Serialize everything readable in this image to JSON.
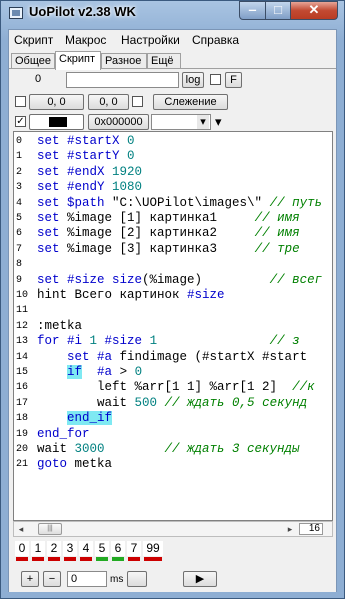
{
  "window": {
    "title": "UoPilot  v2.38  WK",
    "min_glyph": "‒",
    "max_glyph": "□",
    "close_glyph": "✕"
  },
  "menu": [
    "Скрипт",
    "Макрос",
    "Настройки",
    "Справка"
  ],
  "tabs": [
    "Общее",
    "Скрипт",
    "Разное",
    "Ещё"
  ],
  "active_tab": "Скрипт",
  "row1": {
    "value": "0",
    "log_label": "log",
    "f_label": "F"
  },
  "row2": {
    "coord1": "0, 0",
    "coord2": "0, 0",
    "tracking_label": "Слежение"
  },
  "row3": {
    "color_value": "0x000000",
    "dropdown_glyph": "▾",
    "arrow_glyph": "▾"
  },
  "code": [
    {
      "n": "0",
      "parts": [
        {
          "t": "set ",
          "c": "kw"
        },
        {
          "t": "#startX ",
          "c": "kw"
        },
        {
          "t": "0",
          "c": "num"
        }
      ]
    },
    {
      "n": "1",
      "parts": [
        {
          "t": "set ",
          "c": "kw"
        },
        {
          "t": "#startY ",
          "c": "kw"
        },
        {
          "t": "0",
          "c": "num"
        }
      ]
    },
    {
      "n": "2",
      "parts": [
        {
          "t": "set ",
          "c": "kw"
        },
        {
          "t": "#endX ",
          "c": "kw"
        },
        {
          "t": "1920",
          "c": "num"
        }
      ]
    },
    {
      "n": "3",
      "parts": [
        {
          "t": "set ",
          "c": "kw"
        },
        {
          "t": "#endY ",
          "c": "kw"
        },
        {
          "t": "1080",
          "c": "num"
        }
      ]
    },
    {
      "n": "4",
      "parts": [
        {
          "t": "set ",
          "c": "kw"
        },
        {
          "t": "$path ",
          "c": "kw"
        },
        {
          "t": "\"C:\\UOPilot\\images\\\"",
          "c": ""
        },
        {
          "t": " // путь",
          "c": "cmt"
        }
      ]
    },
    {
      "n": "5",
      "parts": [
        {
          "t": "set ",
          "c": "kw"
        },
        {
          "t": "%image ",
          "c": ""
        },
        {
          "t": "[1] картинка1     ",
          "c": ""
        },
        {
          "t": "// имя",
          "c": "cmt"
        }
      ]
    },
    {
      "n": "6",
      "parts": [
        {
          "t": "set ",
          "c": "kw"
        },
        {
          "t": "%image ",
          "c": ""
        },
        {
          "t": "[2] картинка2     ",
          "c": ""
        },
        {
          "t": "// имя",
          "c": "cmt"
        }
      ]
    },
    {
      "n": "7",
      "parts": [
        {
          "t": "set ",
          "c": "kw"
        },
        {
          "t": "%image ",
          "c": ""
        },
        {
          "t": "[3] картинка3     ",
          "c": ""
        },
        {
          "t": "// тре",
          "c": "cmt"
        }
      ]
    },
    {
      "n": "8",
      "parts": []
    },
    {
      "n": "9",
      "parts": [
        {
          "t": "set ",
          "c": "kw"
        },
        {
          "t": "#size ",
          "c": "kw"
        },
        {
          "t": "size",
          "c": "kw"
        },
        {
          "t": "(%image)         ",
          "c": ""
        },
        {
          "t": "// всег",
          "c": "cmt"
        }
      ]
    },
    {
      "n": "10",
      "parts": [
        {
          "t": "hint Всего картинок ",
          "c": ""
        },
        {
          "t": "#size",
          "c": "kw"
        }
      ]
    },
    {
      "n": "11",
      "parts": []
    },
    {
      "n": "12",
      "parts": [
        {
          "t": ":metka",
          "c": ""
        }
      ]
    },
    {
      "n": "13",
      "parts": [
        {
          "t": "for ",
          "c": "kw"
        },
        {
          "t": "#i ",
          "c": "kw"
        },
        {
          "t": "1 ",
          "c": "num"
        },
        {
          "t": "#size ",
          "c": "kw"
        },
        {
          "t": "1",
          "c": "num"
        },
        {
          "t": "               // з",
          "c": "cmt"
        }
      ]
    },
    {
      "n": "14",
      "parts": [
        {
          "t": "    set ",
          "c": "kw"
        },
        {
          "t": "#a ",
          "c": "kw"
        },
        {
          "t": "findimage ",
          "c": ""
        },
        {
          "t": "(#startX #start",
          "c": ""
        }
      ]
    },
    {
      "n": "15",
      "parts": [
        {
          "t": "    ",
          "c": ""
        },
        {
          "t": "if",
          "c": "kw hl"
        },
        {
          "t": "  ",
          "c": ""
        },
        {
          "t": "#a ",
          "c": "kw"
        },
        {
          "t": "> ",
          "c": ""
        },
        {
          "t": "0",
          "c": "num"
        }
      ]
    },
    {
      "n": "16",
      "parts": [
        {
          "t": "        left ",
          "c": ""
        },
        {
          "t": "%arr[1 1] %arr[1 2]  ",
          "c": ""
        },
        {
          "t": "//к",
          "c": "cmt"
        }
      ]
    },
    {
      "n": "17",
      "parts": [
        {
          "t": "        wait ",
          "c": ""
        },
        {
          "t": "500",
          "c": "num"
        },
        {
          "t": " // ждать 0,5 секунд",
          "c": "cmt"
        }
      ]
    },
    {
      "n": "18",
      "parts": [
        {
          "t": "    ",
          "c": ""
        },
        {
          "t": "end_if",
          "c": "kw hl"
        }
      ]
    },
    {
      "n": "19",
      "parts": [
        {
          "t": "end_for",
          "c": "kw"
        }
      ]
    },
    {
      "n": "20",
      "parts": [
        {
          "t": "wait ",
          "c": ""
        },
        {
          "t": "3000",
          "c": "num"
        },
        {
          "t": "        // ждать 3 секунды",
          "c": "cmt"
        }
      ]
    },
    {
      "n": "21",
      "parts": [
        {
          "t": "goto ",
          "c": "kw"
        },
        {
          "t": "metka",
          "c": ""
        }
      ]
    }
  ],
  "hscroll": {
    "left_glyph": "◂",
    "right_glyph": "▸",
    "thumb_glyph": "|||",
    "line_number": "16"
  },
  "slots": [
    {
      "label": "0",
      "color": "#cc0000"
    },
    {
      "label": "1",
      "color": "#cc0000"
    },
    {
      "label": "2",
      "color": "#cc0000"
    },
    {
      "label": "3",
      "color": "#cc0000"
    },
    {
      "label": "4",
      "color": "#cc0000"
    },
    {
      "label": "5",
      "color": "#22aa22"
    },
    {
      "label": "6",
      "color": "#22aa22"
    },
    {
      "label": "7",
      "color": "#cc0000"
    },
    {
      "label": "99",
      "color": "#cc0000"
    }
  ],
  "bottom": {
    "plus": "+",
    "minus": "−",
    "ms_value": "0",
    "ms_label": "ms",
    "play_glyph": "▶"
  },
  "colors": {
    "keyword": "#0000cc",
    "number": "#008080",
    "comment": "#008000",
    "highlight": "#7fe9f2"
  }
}
